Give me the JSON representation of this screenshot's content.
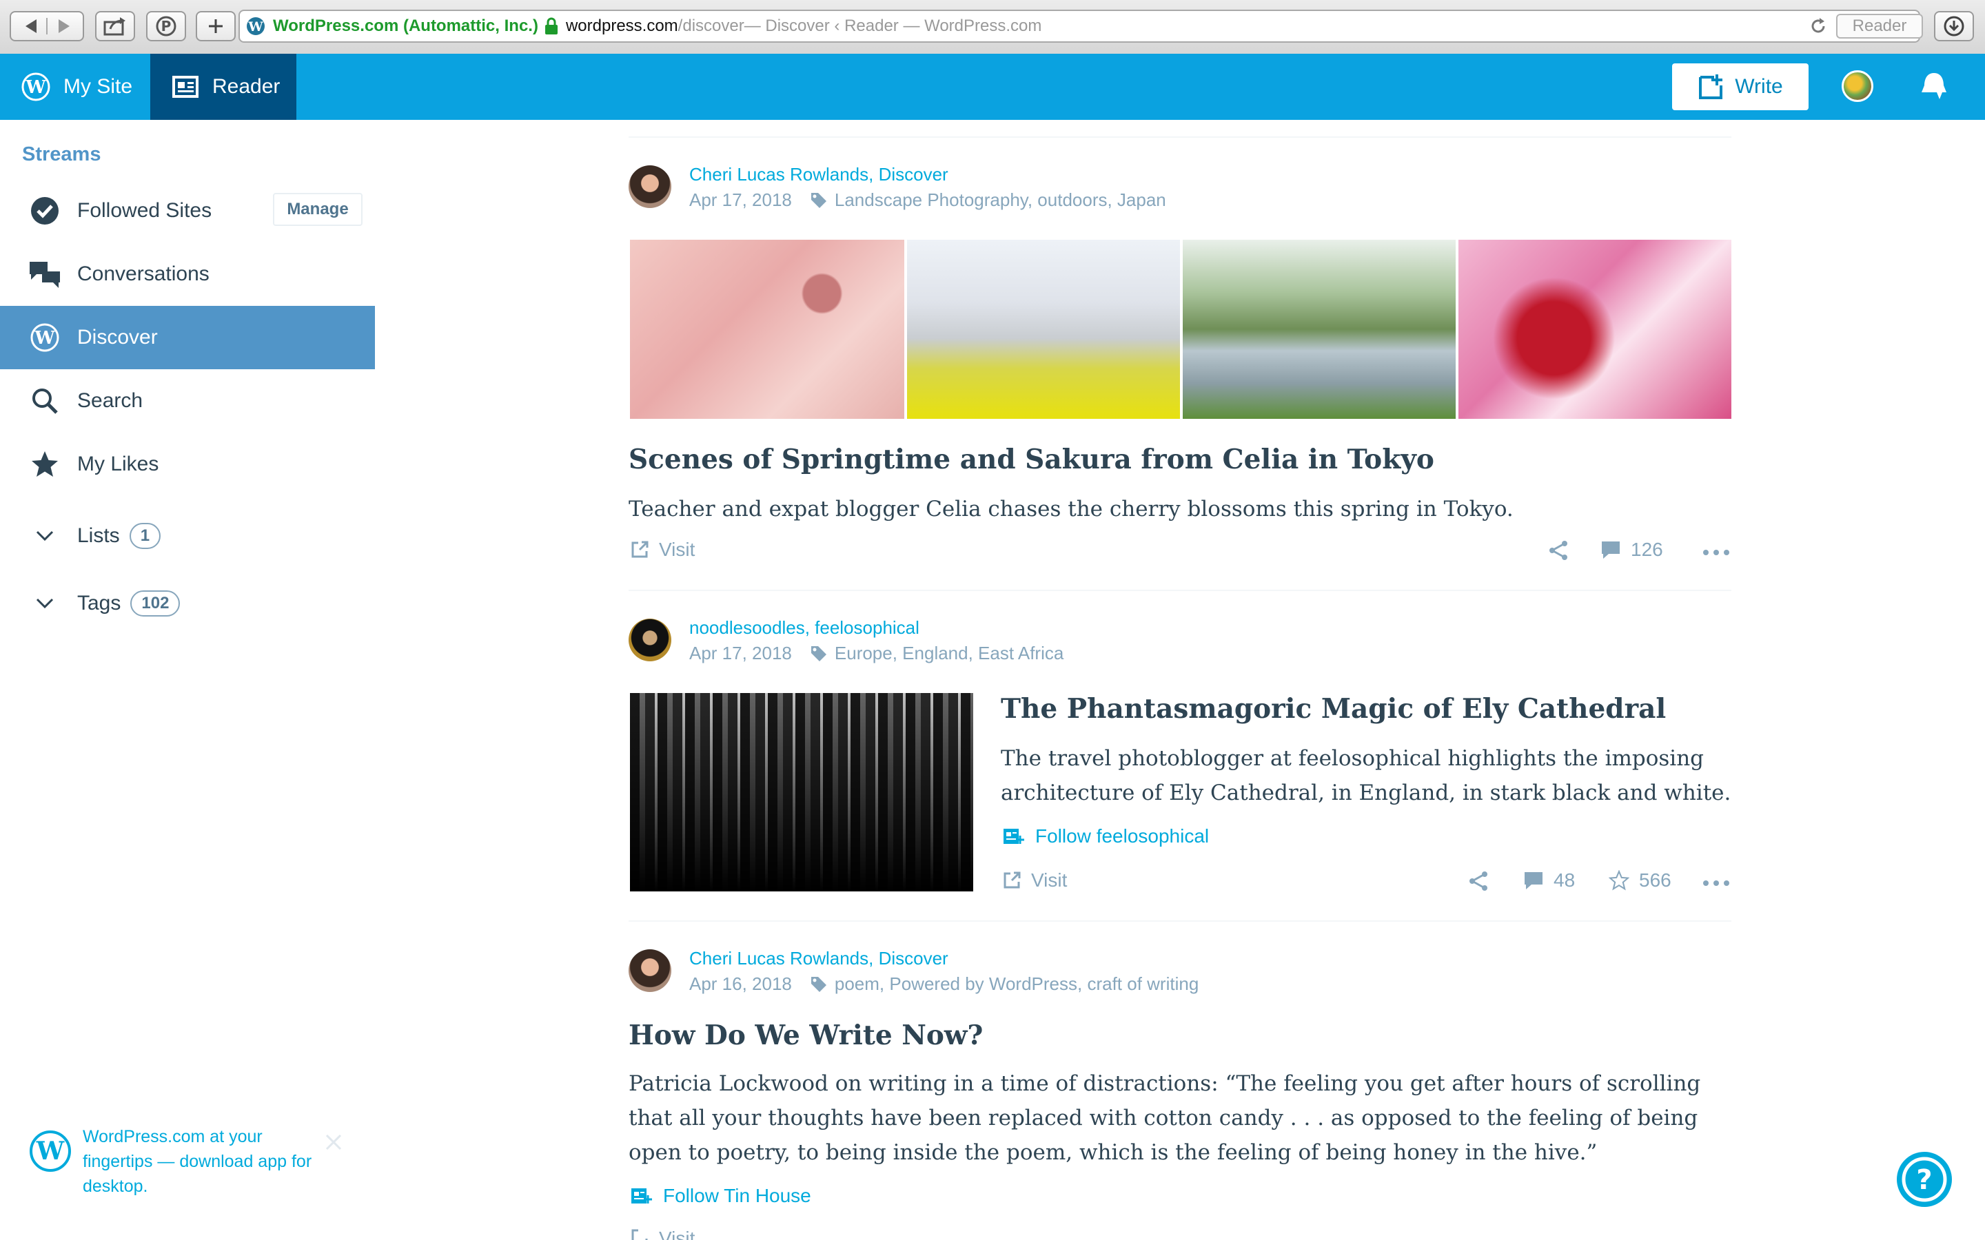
{
  "browser": {
    "cert_owner": "WordPress.com (Automattic, Inc.)",
    "url_host": "wordpress.com",
    "url_path": "/discover",
    "page_title": " — Discover ‹ Reader — WordPress.com",
    "reader_label": "Reader"
  },
  "masterbar": {
    "my_site_label": "My Site",
    "reader_label": "Reader",
    "write_label": "Write"
  },
  "colors": {
    "brand_blue": "#0aa2e0",
    "reader_active": "#005082",
    "sidebar_active": "#5195c8",
    "link": "#00aadc",
    "meta": "#87a6bc",
    "text": "#2e4453"
  },
  "sidebar": {
    "heading": "Streams",
    "manage_label": "Manage",
    "items": [
      {
        "label": "Followed Sites",
        "icon": "check-circle-icon"
      },
      {
        "label": "Conversations",
        "icon": "chat-bubbles-icon"
      },
      {
        "label": "Discover",
        "icon": "wordpress-icon"
      },
      {
        "label": "Search",
        "icon": "search-icon"
      },
      {
        "label": "My Likes",
        "icon": "star-icon"
      }
    ],
    "lists_label": "Lists",
    "lists_count": "1",
    "tags_label": "Tags",
    "tags_count": "102",
    "promo_text": "WordPress.com at your fingertips — download app for desktop."
  },
  "posts": [
    {
      "author": "Cheri Lucas Rowlands, Discover",
      "date": "Apr 17, 2018",
      "tags": "Landscape Photography, outdoors, Japan",
      "title": "Scenes of Springtime and Sakura from Celia in Tokyo",
      "excerpt": "Teacher and expat blogger Celia chases the cherry blossoms this spring in Tokyo.",
      "visit_label": "Visit",
      "comments": "126"
    },
    {
      "author": "noodlesoodles, feelosophical",
      "date": "Apr 17, 2018",
      "tags": "Europe, England, East Africa",
      "title": "The Phantasmagoric Magic of Ely Cathedral",
      "excerpt": "The travel photoblogger at feelosophical highlights the imposing architecture of Ely Cathedral, in England, in stark black and white.",
      "follow_label": "Follow feelosophical",
      "visit_label": "Visit",
      "comments": "48",
      "likes": "566"
    },
    {
      "author": "Cheri Lucas Rowlands, Discover",
      "date": "Apr 16, 2018",
      "tags": "poem, Powered by WordPress, craft of writing",
      "title": "How Do We Write Now?",
      "excerpt": "Patricia Lockwood on writing in a time of distractions: “The feeling you get after hours of scrolling that all your thoughts have been replaced with cotton candy . . . as opposed to the feeling of being open to poetry, to being inside the poem, which is the feeling of being honey in the hive.”",
      "follow_label": "Follow Tin House",
      "visit_label": "Visit"
    }
  ]
}
